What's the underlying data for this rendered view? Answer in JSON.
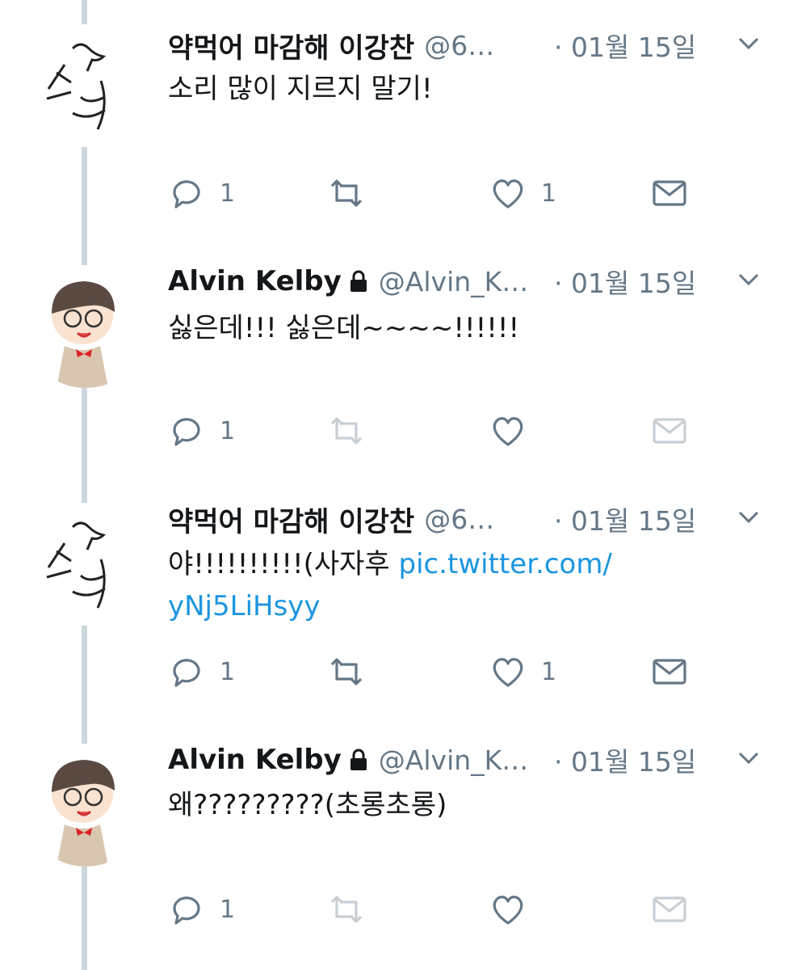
{
  "tweets": [
    {
      "name": "약먹어 마감해 이강찬",
      "handle": "@6…",
      "dot": "·",
      "time": "01월 15일",
      "text": "소리 많이 지르지 말기!",
      "link_text": "",
      "reply_count": "1",
      "retweet_count": "",
      "like_count": "1",
      "retweet_active": true,
      "dm_active": true
    },
    {
      "name": "Alvin Kelby",
      "handle": "@Alvin_K…",
      "dot": "·",
      "time": "01월 15일",
      "text": "싫은데!!! 싫은데~~~~!!!!!!",
      "link_text": "",
      "reply_count": "1",
      "retweet_count": "",
      "like_count": "",
      "retweet_active": false,
      "dm_active": false
    },
    {
      "name": "약먹어 마감해 이강찬",
      "handle": "@6…",
      "dot": "·",
      "time": "01월 15일",
      "text": "야!!!!!!!!!!(사자후 ",
      "link_text": "pic.twitter.com/ yNj5LiHsyy",
      "reply_count": "1",
      "retweet_count": "",
      "like_count": "1",
      "retweet_active": true,
      "dm_active": true
    },
    {
      "name": "Alvin Kelby",
      "handle": "@Alvin_K…",
      "dot": "·",
      "time": "01월 15일",
      "text": "왜?????????(초롱초롱)",
      "link_text": "",
      "reply_count": "1",
      "retweet_count": "",
      "like_count": "",
      "retweet_active": false,
      "dm_active": false
    }
  ],
  "colors": {
    "text": "#14171a",
    "secondary": "#657786",
    "link": "#1b95e0",
    "thread_line": "#ccd6dd"
  },
  "icons": [
    "reply-icon",
    "retweet-icon",
    "like-icon",
    "direct-message-icon",
    "lock-icon",
    "chevron-down-icon"
  ]
}
